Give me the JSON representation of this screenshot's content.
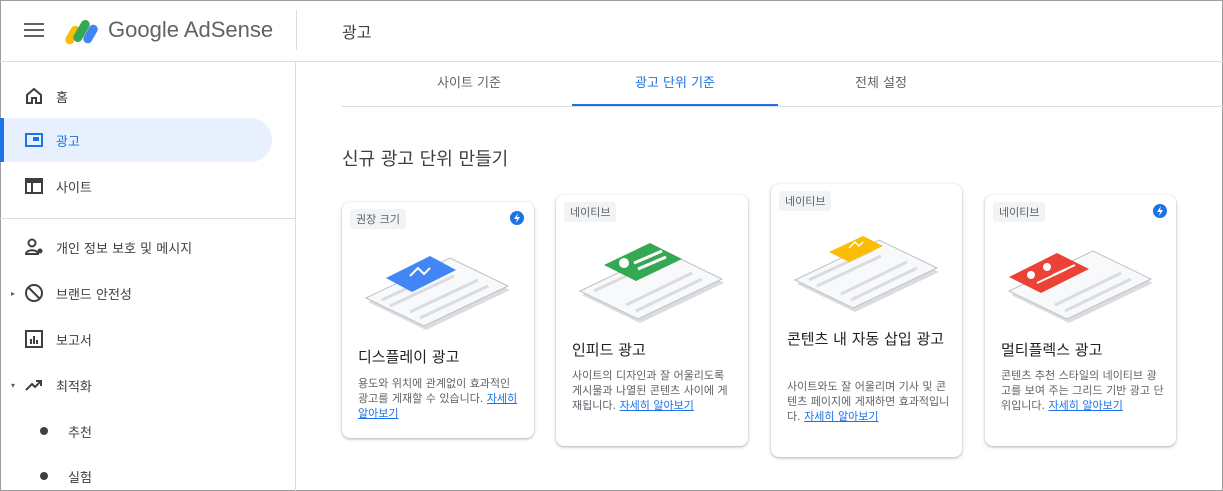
{
  "app": {
    "brand": "Google AdSense",
    "page_title": "광고"
  },
  "sidebar": {
    "items": [
      {
        "label": "홈"
      },
      {
        "label": "광고"
      },
      {
        "label": "사이트"
      },
      {
        "label": "개인 정보 보호 및 메시지"
      },
      {
        "label": "브랜드 안전성"
      },
      {
        "label": "보고서"
      },
      {
        "label": "최적화"
      },
      {
        "label": "추천"
      },
      {
        "label": "실험"
      }
    ]
  },
  "tabs": [
    {
      "label": "사이트 기준"
    },
    {
      "label": "광고 단위 기준"
    },
    {
      "label": "전체 설정"
    }
  ],
  "main": {
    "section_title": "신규 광고 단위 만들기",
    "cards": [
      {
        "chip": "권장 크기",
        "title": "디스플레이 광고",
        "desc": "용도와 위치에 관계없이 효과적인 광고를 게재할 수 있습니다.",
        "link": "자세히 알아보기"
      },
      {
        "chip": "네이티브",
        "title": "인피드 광고",
        "desc": "사이트의 디자인과 잘 어울리도록 게시물과 나열된 콘텐츠 사이에 게재됩니다.",
        "link": "자세히 알아보기"
      },
      {
        "chip": "네이티브",
        "title": "콘텐츠 내 자동 삽입 광고",
        "desc": "사이트와도 잘 어울리며 기사 및 콘텐츠 페이지에 게재하면 효과적입니다.",
        "link": "자세히 알아보기"
      },
      {
        "chip": "네이티브",
        "title": "멀티플렉스 광고",
        "desc": "콘텐츠 추천 스타일의 네이티브 광고를 보여 주는 그리드 기반 광고 단위입니다.",
        "link": "자세히 알아보기"
      }
    ]
  },
  "colors": {
    "accent": "#1a73e8",
    "display": "#4285f4",
    "infeed": "#34a853",
    "inarticle": "#fbbc04",
    "multiplex": "#ea4335"
  }
}
